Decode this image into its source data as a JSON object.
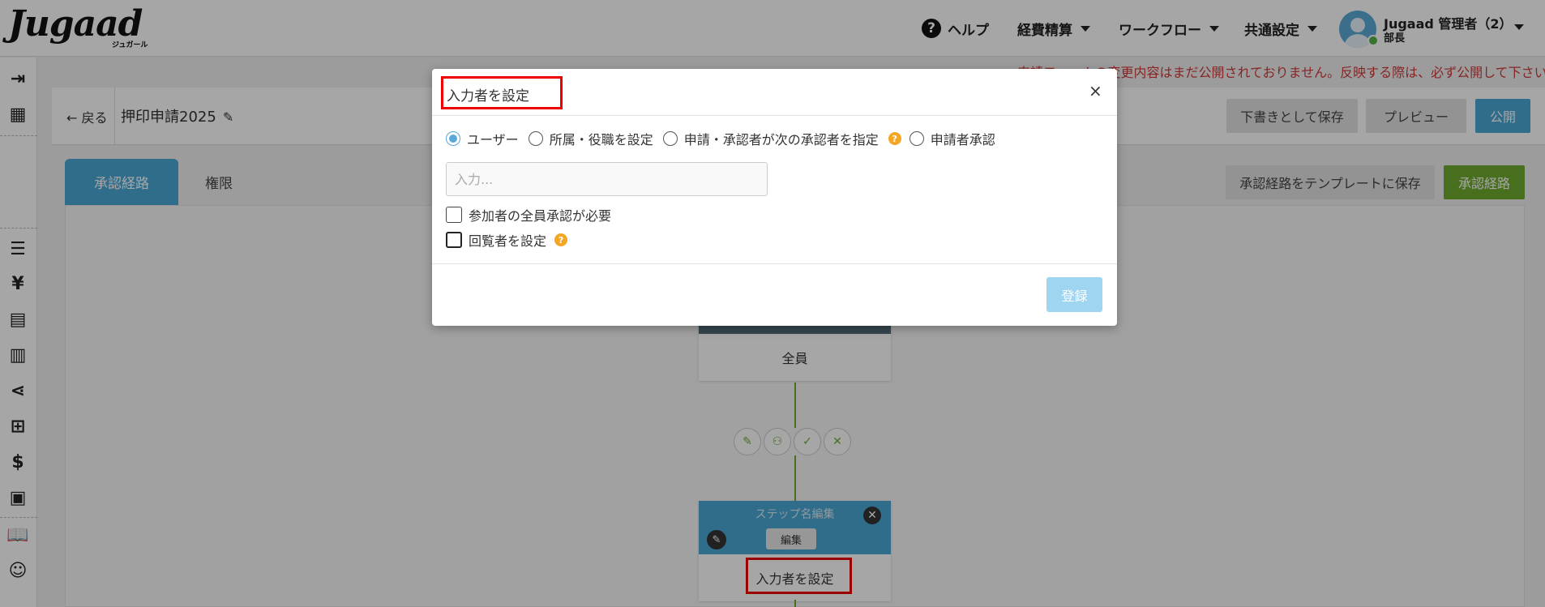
{
  "header": {
    "logo": "Jugaad",
    "logo_sub": "ジュガール",
    "help": "ヘルプ",
    "menu": [
      "経費精算",
      "ワークフロー",
      "共通設定"
    ],
    "user_name": "Jugaad 管理者（2）",
    "user_role": "部長"
  },
  "notice": "申請フォームの変更内容はまだ公開されておりません。反映する際は、必ず公開して下さい",
  "editor": {
    "back": "← 戻る",
    "form_name": "押印申請2025",
    "save_draft": "下書きとして保存",
    "preview": "プレビュー",
    "publish": "公開",
    "tabs": [
      "承認経路",
      "権限"
    ],
    "save_template": "承認経路をテンプレートに保存",
    "route_button": "承認経路"
  },
  "flow": {
    "node_all": "全員",
    "step_title": "ステップ名編集",
    "step_edit": "編集",
    "step_input_setting": "入力者を設定"
  },
  "modal": {
    "title": "入力者を設定",
    "close": "×",
    "options": [
      "ユーザー",
      "所属・役職を設定",
      "申請・承認者が次の承認者を指定",
      "申請者承認"
    ],
    "selected_option": "ユーザー",
    "input_placeholder": "入力...",
    "check_all_approve": "参加者の全員承認が必要",
    "check_viewer": "回覧者を設定",
    "register": "登録"
  },
  "colors": {
    "accent_blue": "#4ba8d6",
    "accent_green": "#6fab2e",
    "highlight_red": "#e00000",
    "warning_text": "#d03a3a"
  }
}
